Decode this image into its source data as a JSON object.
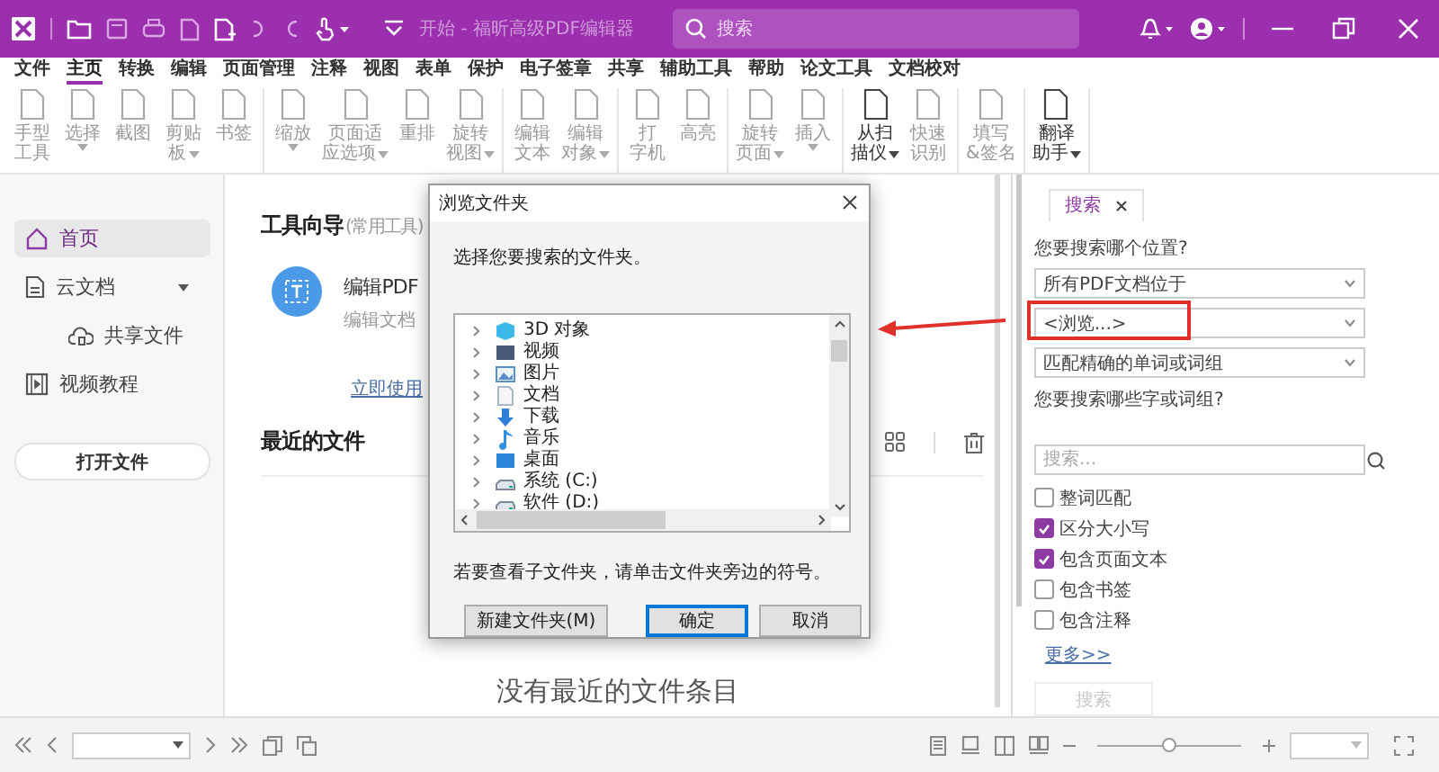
{
  "title_bar": {
    "title": "开始 - 福昕高级PDF编辑器",
    "search": {
      "placeholder": "搜索"
    }
  },
  "menu_tabs": [
    {
      "label": "文件",
      "selected": false
    },
    {
      "label": "主页",
      "selected": true
    },
    {
      "label": "转换",
      "selected": false
    },
    {
      "label": "编辑",
      "selected": false
    },
    {
      "label": "页面管理",
      "selected": false
    },
    {
      "label": "注释",
      "selected": false
    },
    {
      "label": "视图",
      "selected": false
    },
    {
      "label": "表单",
      "selected": false
    },
    {
      "label": "保护",
      "selected": false
    },
    {
      "label": "电子签章",
      "selected": false
    },
    {
      "label": "共享",
      "selected": false
    },
    {
      "label": "辅助工具",
      "selected": false
    },
    {
      "label": "帮助",
      "selected": false
    },
    {
      "label": "论文工具",
      "selected": false
    },
    {
      "label": "文档校对",
      "selected": false
    }
  ],
  "ribbon": {
    "groups": [
      [
        {
          "lines": [
            "手型",
            "工具"
          ],
          "dropdown": false,
          "disabled": true
        },
        {
          "lines": [
            "选择"
          ],
          "dropdown": true,
          "caret_below": true,
          "disabled": true
        },
        {
          "lines": [
            "截图"
          ],
          "dropdown": false,
          "disabled": true
        },
        {
          "lines": [
            "剪贴",
            "板"
          ],
          "dropdown": true,
          "caret_below": false,
          "disabled": true
        },
        {
          "lines": [
            "书签"
          ],
          "dropdown": false,
          "disabled": true
        }
      ],
      [
        {
          "lines": [
            "缩放"
          ],
          "dropdown": true,
          "caret_below": true,
          "disabled": true
        },
        {
          "lines": [
            "页面适",
            "应选项"
          ],
          "dropdown": true,
          "caret_below": false,
          "disabled": true
        },
        {
          "lines": [
            "重排"
          ],
          "dropdown": false,
          "disabled": true
        },
        {
          "lines": [
            "旋转",
            "视图"
          ],
          "dropdown": true,
          "caret_below": false,
          "disabled": true
        }
      ],
      [
        {
          "lines": [
            "编辑",
            "文本"
          ],
          "dropdown": false,
          "disabled": true
        },
        {
          "lines": [
            "编辑",
            "对象"
          ],
          "dropdown": true,
          "caret_below": false,
          "disabled": true
        }
      ],
      [
        {
          "lines": [
            "打",
            "字机"
          ],
          "dropdown": false,
          "disabled": true
        },
        {
          "lines": [
            "高亮"
          ],
          "dropdown": false,
          "disabled": true
        }
      ],
      [
        {
          "lines": [
            "旋转",
            "页面"
          ],
          "dropdown": true,
          "caret_below": false,
          "disabled": true
        },
        {
          "lines": [
            "插入"
          ],
          "dropdown": true,
          "caret_below": true,
          "disabled": true
        }
      ],
      [
        {
          "lines": [
            "从扫",
            "描仪"
          ],
          "dropdown": true,
          "caret_below": false,
          "disabled": false
        },
        {
          "lines": [
            "快速",
            "识别"
          ],
          "dropdown": false,
          "disabled": true
        }
      ],
      [
        {
          "lines": [
            "填写",
            "&签名"
          ],
          "dropdown": false,
          "disabled": true
        }
      ],
      [
        {
          "lines": [
            "翻译",
            "助手"
          ],
          "dropdown": true,
          "caret_below": false,
          "disabled": false
        }
      ]
    ]
  },
  "sidebar": {
    "items": [
      {
        "label": "首页",
        "selected": true
      },
      {
        "label": "云文档",
        "selected": false,
        "expanded": true,
        "children": [
          {
            "label": "共享文件",
            "selected": false
          }
        ]
      },
      {
        "label": "视频教程",
        "selected": false
      }
    ],
    "button": "打开文件"
  },
  "home": {
    "tools_title": "工具向导",
    "tools_subtitle": "(常用工具)",
    "tool_card": {
      "title": "编辑PDF",
      "description": "编辑文档",
      "action": "立即使用"
    },
    "recent_title": "最近的文件",
    "empty_message": "没有最近的文件条目"
  },
  "dialog": {
    "title": "浏览文件夹",
    "prompt": "选择您要搜索的文件夹。",
    "folders": [
      {
        "label": "3D 对象",
        "kind": "objects"
      },
      {
        "label": "视频",
        "kind": "videos"
      },
      {
        "label": "图片",
        "kind": "pictures"
      },
      {
        "label": "文档",
        "kind": "documents"
      },
      {
        "label": "下载",
        "kind": "downloads"
      },
      {
        "label": "音乐",
        "kind": "music"
      },
      {
        "label": "桌面",
        "kind": "desktop"
      },
      {
        "label": "系统 (C:)",
        "kind": "drive"
      },
      {
        "label": "软件 (D:)",
        "kind": "drive"
      }
    ],
    "hint": "若要查看子文件夹，请单击文件夹旁边的符号。",
    "buttons": [
      {
        "label": "新建文件夹(M)",
        "default": false
      },
      {
        "label": "确定",
        "default": true
      },
      {
        "label": "取消",
        "default": false
      }
    ]
  },
  "search_panel": {
    "tab": {
      "label": "搜索",
      "selected": true
    },
    "where_label": "您要搜索哪个位置?",
    "selects": [
      {
        "value": "所有PDF文档位于"
      },
      {
        "value": "<浏览...>"
      },
      {
        "value": "匹配精确的单词或词组"
      }
    ],
    "what_label": "您要搜索哪些字或词组?",
    "search_field": {
      "placeholder": "搜索..."
    },
    "options": [
      {
        "label": "整词匹配",
        "checked": false
      },
      {
        "label": "区分大小写",
        "checked": true
      },
      {
        "label": "包含页面文本",
        "checked": true
      },
      {
        "label": "包含书签",
        "checked": false
      },
      {
        "label": "包含注释",
        "checked": false
      }
    ],
    "more_link": "更多>>",
    "search_button": {
      "label": "搜索",
      "disabled": true
    }
  },
  "status_bar": {
    "zoom": {
      "level": 0.5
    }
  },
  "annotations": {
    "arrow": {
      "color": "#e0302a"
    },
    "highlight_frame": {
      "color": "#e0302a"
    }
  }
}
